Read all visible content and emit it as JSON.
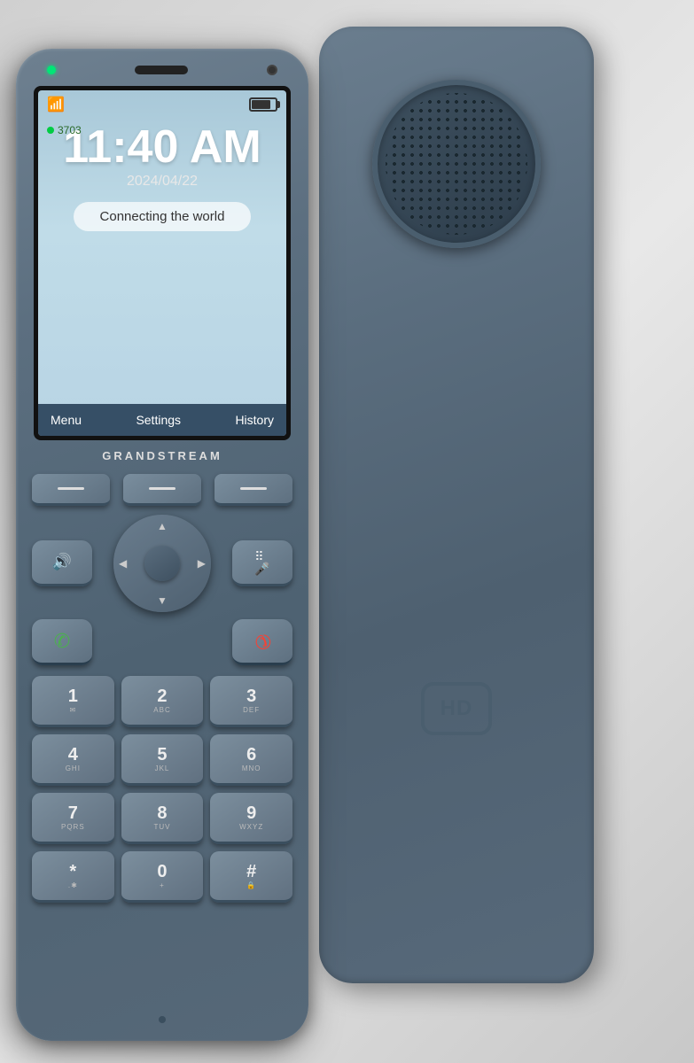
{
  "scene": {
    "background_color": "#e0e4e8"
  },
  "phone_front": {
    "led_color": "#00e676",
    "extension": "3703",
    "time": "11:40 AM",
    "date": "2024/04/22",
    "message": "Connecting the world",
    "softkeys": {
      "left": "Menu",
      "center": "Settings",
      "right": "History"
    },
    "brand": "GRANDSTREAM",
    "keys": {
      "softkey_lines": [
        "—",
        "—",
        "—"
      ],
      "speaker_icon": "🔊",
      "conf_mute_icon": "⠿",
      "call_icon": "✆",
      "end_icon": "📵",
      "numpad": [
        {
          "num": "1",
          "letters": "✉"
        },
        {
          "num": "2",
          "letters": "ABC"
        },
        {
          "num": "3",
          "letters": "DEF"
        },
        {
          "num": "4",
          "letters": "GHI"
        },
        {
          "num": "5",
          "letters": "JKL"
        },
        {
          "num": "6",
          "letters": "MNO"
        },
        {
          "num": "7",
          "letters": "PQRS"
        },
        {
          "num": "8",
          "letters": "TUV"
        },
        {
          "num": "9",
          "letters": "WXYZ"
        },
        {
          "num": "*",
          "letters": ".✱"
        },
        {
          "num": "0",
          "letters": "+"
        },
        {
          "num": "#",
          "letters": "🔒"
        }
      ]
    }
  },
  "phone_back": {
    "hd_label": "HD"
  }
}
